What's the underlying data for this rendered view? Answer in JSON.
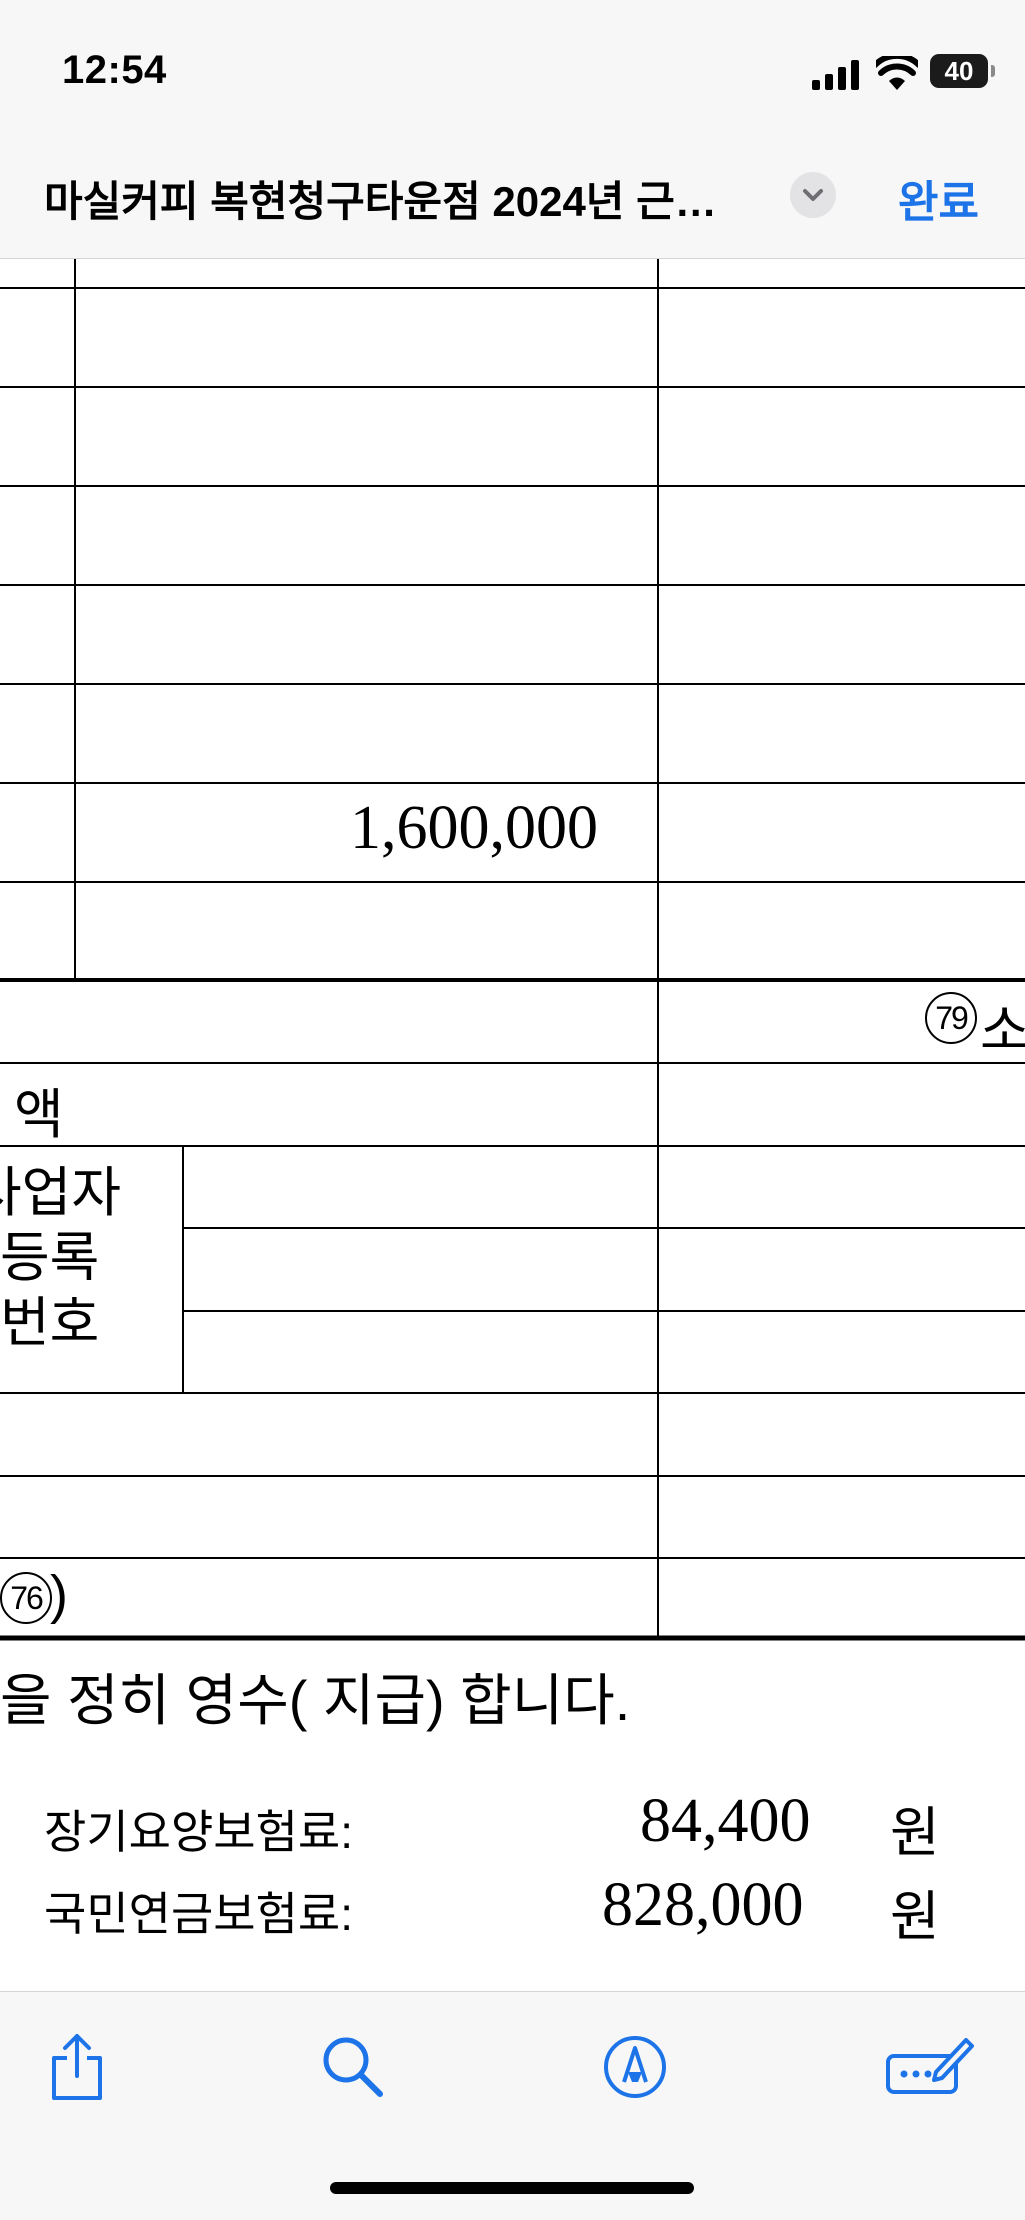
{
  "status_bar": {
    "time": "12:54",
    "battery": "40"
  },
  "nav": {
    "title": "마실커피 복현청구타운점 2024년 근…",
    "done_label": "완료"
  },
  "document": {
    "amount_row": "1,600,000",
    "marker_79": "79",
    "marker_79_text": "소",
    "label_amount": "액",
    "label_biz_line1": "사업자",
    "label_biz_line2": "등록",
    "label_biz_line3": "번호",
    "marker_76": "76",
    "marker_76_close": ")",
    "receipt_sentence": "을 정히 영수( 지급) 합니다.",
    "ltc_label": "장기요양보험료:",
    "ltc_value": "84,400",
    "pension_label": "국민연금보험료:",
    "pension_value": "828,000",
    "currency": "원"
  },
  "toolbar": {
    "icons": [
      "share-icon",
      "search-icon",
      "markup-icon",
      "form-fill-icon"
    ],
    "accent": "#1d73e8"
  }
}
